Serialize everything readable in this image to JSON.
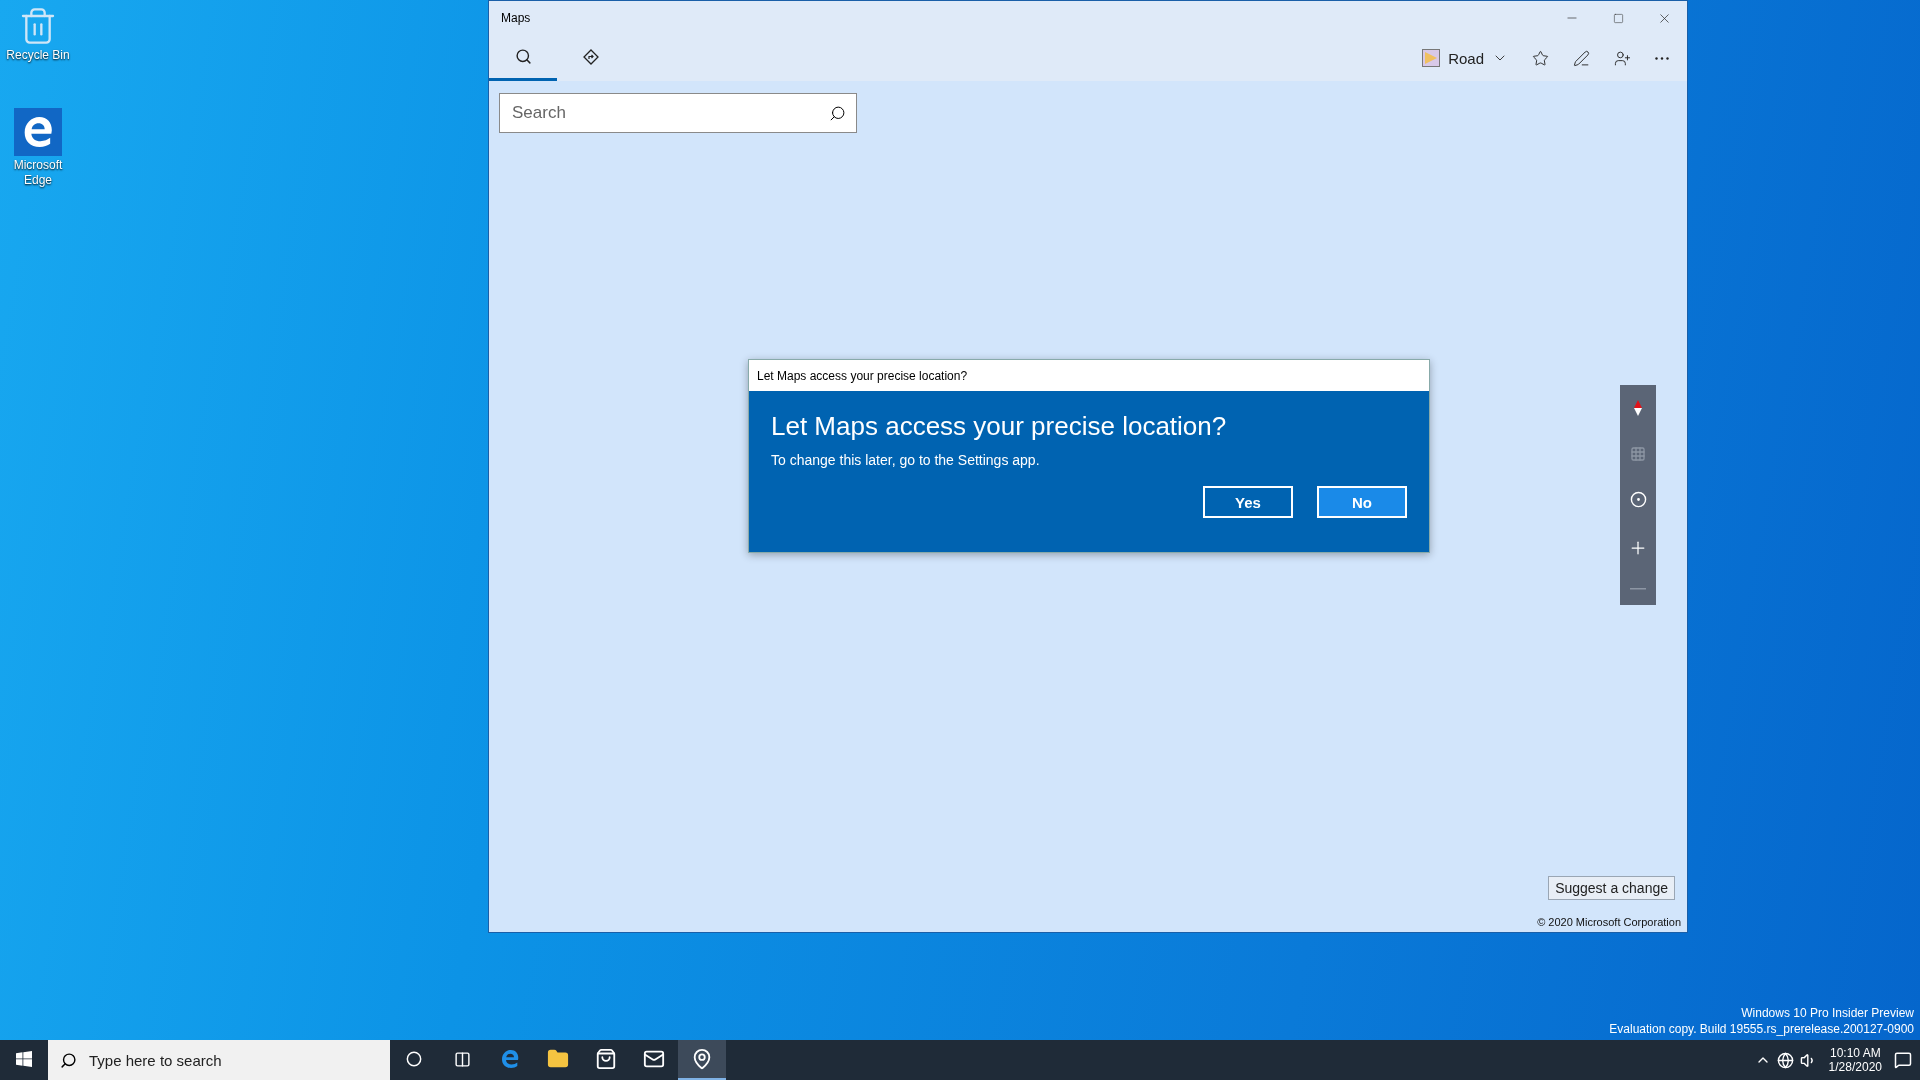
{
  "desktop_icons": [
    {
      "label": "Recycle Bin",
      "kind": "recycle"
    },
    {
      "label": "Microsoft Edge",
      "kind": "edge"
    }
  ],
  "window": {
    "title": "Maps",
    "tabs": [
      {
        "kind": "search",
        "selected": true
      },
      {
        "kind": "directions",
        "selected": false
      }
    ],
    "map_style": "Road",
    "search": {
      "placeholder": "Search"
    },
    "map_controls": [
      {
        "kind": "compass",
        "disabled": false
      },
      {
        "kind": "tilt",
        "disabled": true
      },
      {
        "kind": "locate",
        "disabled": false
      },
      {
        "kind": "zoom-in",
        "disabled": false
      },
      {
        "kind": "zoom-out",
        "disabled": true
      }
    ],
    "suggest_button": "Suggest a change",
    "copyright": "© 2020 Microsoft Corporation"
  },
  "dialog": {
    "title": "Let Maps access your precise location?",
    "heading": "Let Maps access your precise location?",
    "message": "To change this later, go to the Settings app.",
    "buttons": [
      {
        "label": "Yes",
        "selected": false
      },
      {
        "label": "No",
        "selected": true
      }
    ]
  },
  "build_info": [
    "Windows 10 Pro Insider Preview",
    "Evaluation copy. Build 19555.rs_prerelease.200127-0900"
  ],
  "taskbar": {
    "search_placeholder": "Type here to search",
    "apps": [
      {
        "kind": "cortana",
        "active": false
      },
      {
        "kind": "task-view",
        "active": false
      },
      {
        "kind": "edge",
        "active": false
      },
      {
        "kind": "explorer",
        "active": false
      },
      {
        "kind": "store",
        "active": false
      },
      {
        "kind": "mail",
        "active": false
      },
      {
        "kind": "maps",
        "active": true
      }
    ],
    "time": "10:10 AM",
    "date": "1/28/2020"
  }
}
